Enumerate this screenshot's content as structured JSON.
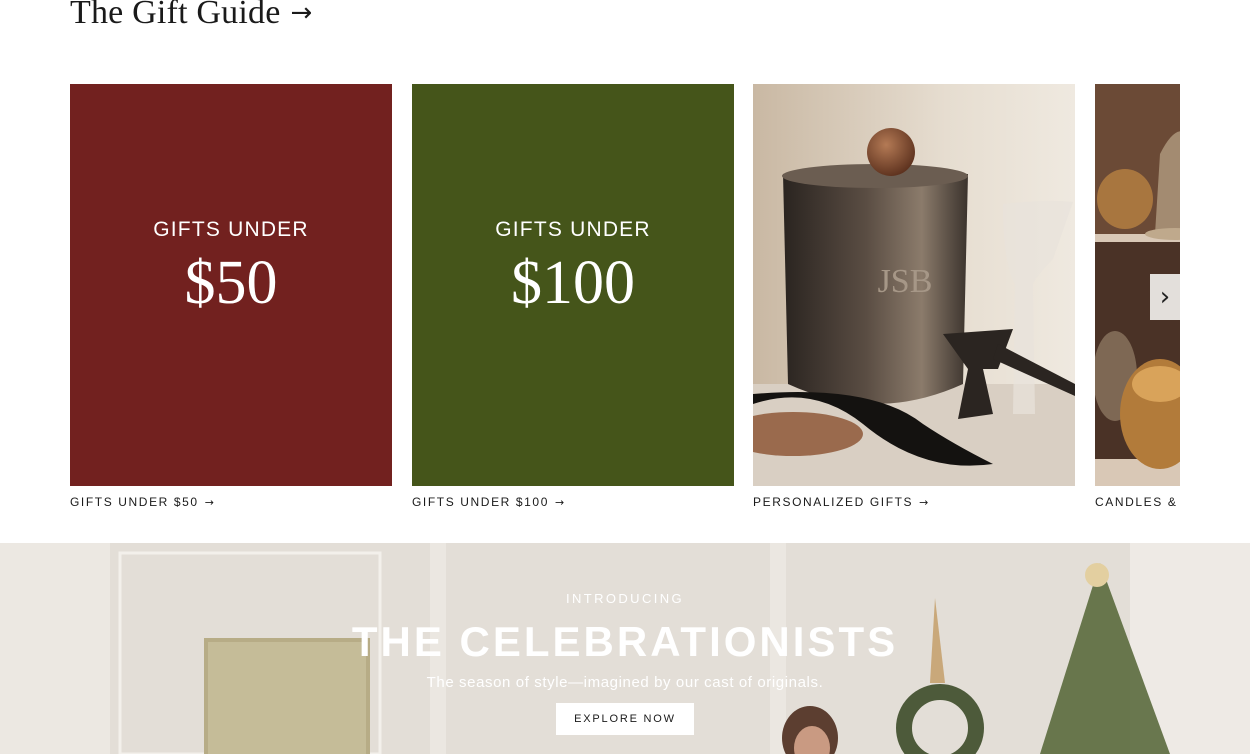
{
  "section": {
    "title": "The Gift Guide",
    "title_arrow": "→"
  },
  "cards": [
    {
      "tile_small": "GIFTS UNDER",
      "tile_big": "$50",
      "caption": "GIFTS UNDER $50",
      "bg": "#72211f"
    },
    {
      "tile_small": "GIFTS UNDER",
      "tile_big": "$100",
      "caption": "GIFTS UNDER $100",
      "bg": "#45551a"
    },
    {
      "tile_small": "",
      "tile_big": "",
      "caption": "PERSONALIZED GIFTS",
      "monogram": "JSB"
    },
    {
      "tile_small": "",
      "tile_big": "",
      "caption": "CANDLES & H"
    }
  ],
  "carousel": {
    "next_icon": "chevron-right-icon",
    "next_glyph": "›"
  },
  "hero": {
    "eyebrow": "INTRODUCING",
    "headline": "THE CELEBRATIONISTS",
    "subtitle": "The season of style—imagined by our cast of originals.",
    "cta": "EXPLORE NOW"
  },
  "colors": {
    "red_tile": "#72211f",
    "green_tile": "#45551a"
  }
}
